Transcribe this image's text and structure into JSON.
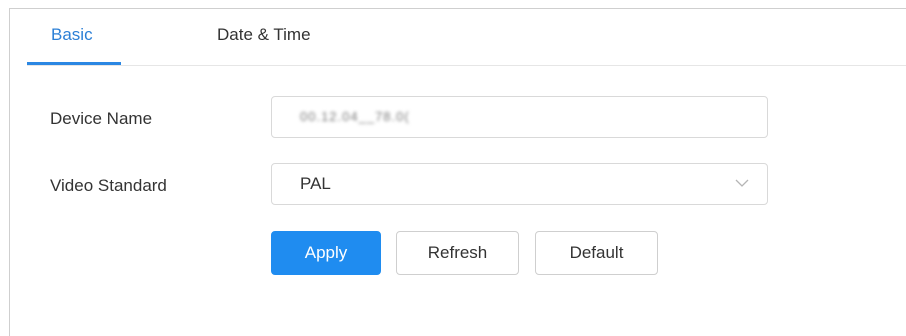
{
  "tabs": [
    {
      "label": "Basic",
      "active": true
    },
    {
      "label": "Date & Time",
      "active": false
    }
  ],
  "form": {
    "device_name": {
      "label": "Device Name",
      "value": "00.12.04__78.0("
    },
    "video_standard": {
      "label": "Video Standard",
      "selected": "PAL",
      "dropdown_icon": "chevron-down-icon"
    }
  },
  "buttons": {
    "apply": "Apply",
    "refresh": "Refresh",
    "default": "Default"
  },
  "colors": {
    "accent": "#1f8cf0",
    "active_tab": "#2b7fd6",
    "border": "#d9d9d9",
    "text": "#333333"
  }
}
